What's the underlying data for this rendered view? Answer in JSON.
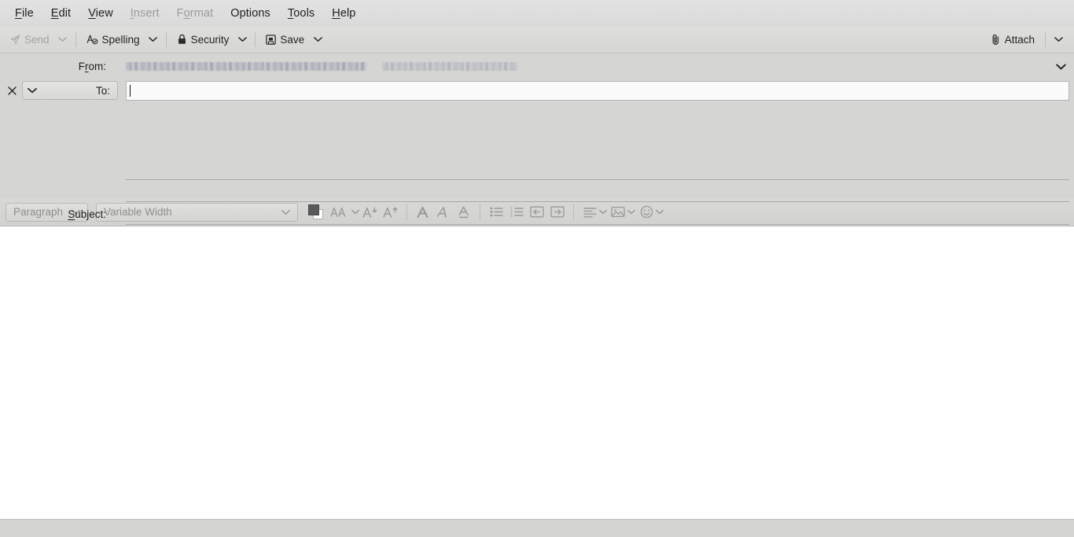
{
  "menubar": {
    "items": [
      {
        "label": "File",
        "accel": "F",
        "disabled": false
      },
      {
        "label": "Edit",
        "accel": "E",
        "disabled": false
      },
      {
        "label": "View",
        "accel": "V",
        "disabled": false
      },
      {
        "label": "Insert",
        "accel": "I",
        "disabled": true
      },
      {
        "label": "Format",
        "accel": "o",
        "disabled": true
      },
      {
        "label": "Options",
        "accel": "",
        "disabled": false
      },
      {
        "label": "Tools",
        "accel": "T",
        "disabled": false
      },
      {
        "label": "Help",
        "accel": "H",
        "disabled": false
      }
    ]
  },
  "toolbar": {
    "send_label": "Send",
    "send_icon": "paper-plane-icon",
    "send_disabled": true,
    "spelling_label": "Spelling",
    "spelling_icon": "spellcheck-icon",
    "security_label": "Security",
    "security_icon": "lock-icon",
    "save_label": "Save",
    "save_icon": "floppy-disk-icon",
    "attach_label": "Attach",
    "attach_icon": "paperclip-icon",
    "caret_icon": "chevron-down-icon"
  },
  "headers": {
    "from": {
      "label": "From:",
      "accel": "r",
      "value": "",
      "redacted": true,
      "caret_icon": "chevron-down-icon"
    },
    "to": {
      "remove_icon": "close-icon",
      "type_caret_icon": "chevron-down-icon",
      "label": "To:",
      "value": "",
      "placeholder": "",
      "focused": true
    },
    "subject": {
      "label": "Subject:",
      "accel": "S",
      "value": "",
      "placeholder": ""
    }
  },
  "formatbar": {
    "paragraph_select": {
      "value": "Paragraph",
      "caret_icon": "chevron-down-icon",
      "disabled": true
    },
    "font_select": {
      "value": "Variable Width",
      "caret_icon": "chevron-down-icon",
      "disabled": true
    },
    "buttons": [
      {
        "name": "text-color-swatch",
        "icon": "color-swatch-icon"
      },
      {
        "name": "font-size-button",
        "icon": "font-size-icon",
        "caret": true
      },
      {
        "name": "decrease-font-size-button",
        "icon": "decrease-font-icon"
      },
      {
        "name": "increase-font-size-button",
        "icon": "increase-font-icon"
      },
      {
        "name": "bold-button",
        "icon": "bold-icon"
      },
      {
        "name": "italic-button",
        "icon": "italic-icon"
      },
      {
        "name": "underline-button",
        "icon": "underline-icon"
      },
      {
        "name": "bullet-list-button",
        "icon": "bullet-list-icon"
      },
      {
        "name": "numbered-list-button",
        "icon": "numbered-list-icon"
      },
      {
        "name": "outdent-button",
        "icon": "outdent-icon"
      },
      {
        "name": "indent-button",
        "icon": "indent-icon"
      },
      {
        "name": "align-button",
        "icon": "align-left-icon",
        "caret": true
      },
      {
        "name": "insert-image-button",
        "icon": "image-icon",
        "caret": true
      },
      {
        "name": "emoji-button",
        "icon": "smiley-icon",
        "caret": true
      }
    ]
  },
  "body": {
    "content": ""
  },
  "statusbar": {
    "text": ""
  },
  "colors": {
    "window_bg": "#d5d5d3",
    "menubar_bg": "#dedede",
    "toolbar_bg": "#d8d8d6",
    "body_bg": "#ffffff",
    "text": "#1d1d1d",
    "disabled_text": "#9b9b9b",
    "border": "#b5b5b3"
  }
}
